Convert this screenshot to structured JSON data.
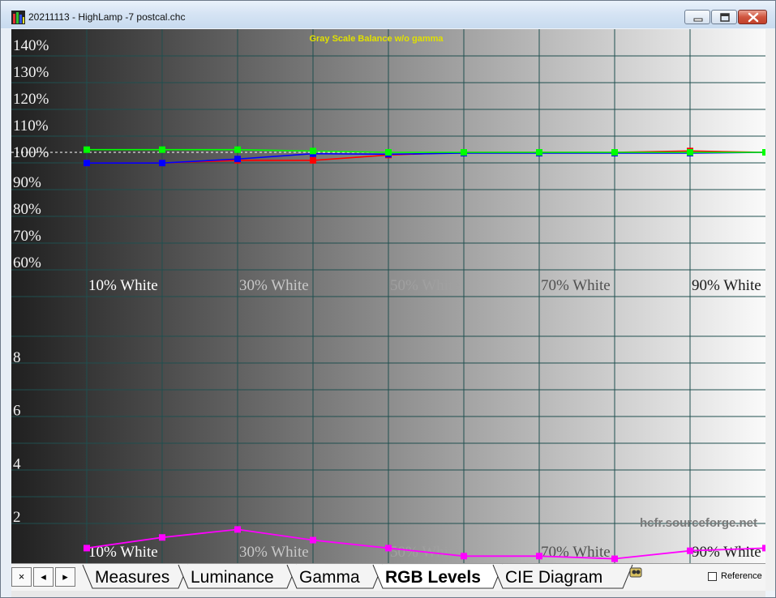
{
  "window": {
    "title": "20211113 - HighLamp -7 postcal.chc",
    "app_icon": "hcfr-bars-icon",
    "controls": [
      "minimize-icon",
      "restore-icon",
      "close-icon"
    ]
  },
  "graph": {
    "title": "Gray Scale Balance w/o gamma",
    "watermark": "hcfr.sourceforge.net",
    "colors": {
      "red": "#ff0000",
      "green": "#00ff00",
      "blue": "#0000ff",
      "delta_e": "#ff00ff",
      "grid": "#1f4f4f",
      "title": "#e0e000",
      "reference_line": "#ffffff"
    }
  },
  "chart_data": [
    {
      "type": "line",
      "title": "Gray Scale Balance w/o gamma",
      "x": [
        10,
        20,
        30,
        40,
        50,
        60,
        70,
        80,
        90,
        100
      ],
      "xtick_labels": [
        "10% White",
        "30% White",
        "50% White",
        "70% White",
        "90% White"
      ],
      "yticks": [
        "140%",
        "130%",
        "120%",
        "110%",
        "100%",
        "90%",
        "80%",
        "70%",
        "60%"
      ],
      "ylim": [
        60,
        140
      ],
      "reference_line": 100,
      "grid": true,
      "series": [
        {
          "color": "#ff0000",
          "values": [
            96,
            96,
            97,
            97,
            99,
            100,
            100,
            100,
            100.5,
            100
          ]
        },
        {
          "color": "#00ff00",
          "values": [
            101,
            101,
            101,
            100.5,
            100,
            100,
            100,
            100,
            100,
            100
          ]
        },
        {
          "color": "#0000ff",
          "values": [
            96,
            96,
            97.5,
            99.5,
            99.3,
            99.7,
            99.7,
            99.7,
            99.7,
            100
          ]
        }
      ]
    },
    {
      "type": "line",
      "x": [
        10,
        20,
        30,
        40,
        50,
        60,
        70,
        80,
        90,
        100
      ],
      "xtick_labels": [
        "10% White",
        "30% White",
        "50% White",
        "70% White",
        "90% White"
      ],
      "yticks": [
        "8",
        "6",
        "4",
        "2"
      ],
      "ylim": [
        0,
        10
      ],
      "grid": true,
      "series": [
        {
          "color": "#ff00ff",
          "values": [
            0.2,
            0.6,
            0.9,
            0.5,
            0.2,
            -0.1,
            -0.1,
            -0.2,
            0.1,
            0.2
          ]
        }
      ]
    }
  ],
  "tabs": {
    "nav_buttons": [
      "×",
      "◂",
      "▸"
    ],
    "items": [
      {
        "label": "Measures",
        "active": false
      },
      {
        "label": "Luminance",
        "active": false
      },
      {
        "label": "Gamma",
        "active": false
      },
      {
        "label": "RGB Levels",
        "active": true
      },
      {
        "label": "CIE Diagram",
        "active": false
      }
    ],
    "extra_icon": "colorimeter-icon",
    "reference_checkbox": {
      "label": "Reference",
      "checked": false
    }
  }
}
